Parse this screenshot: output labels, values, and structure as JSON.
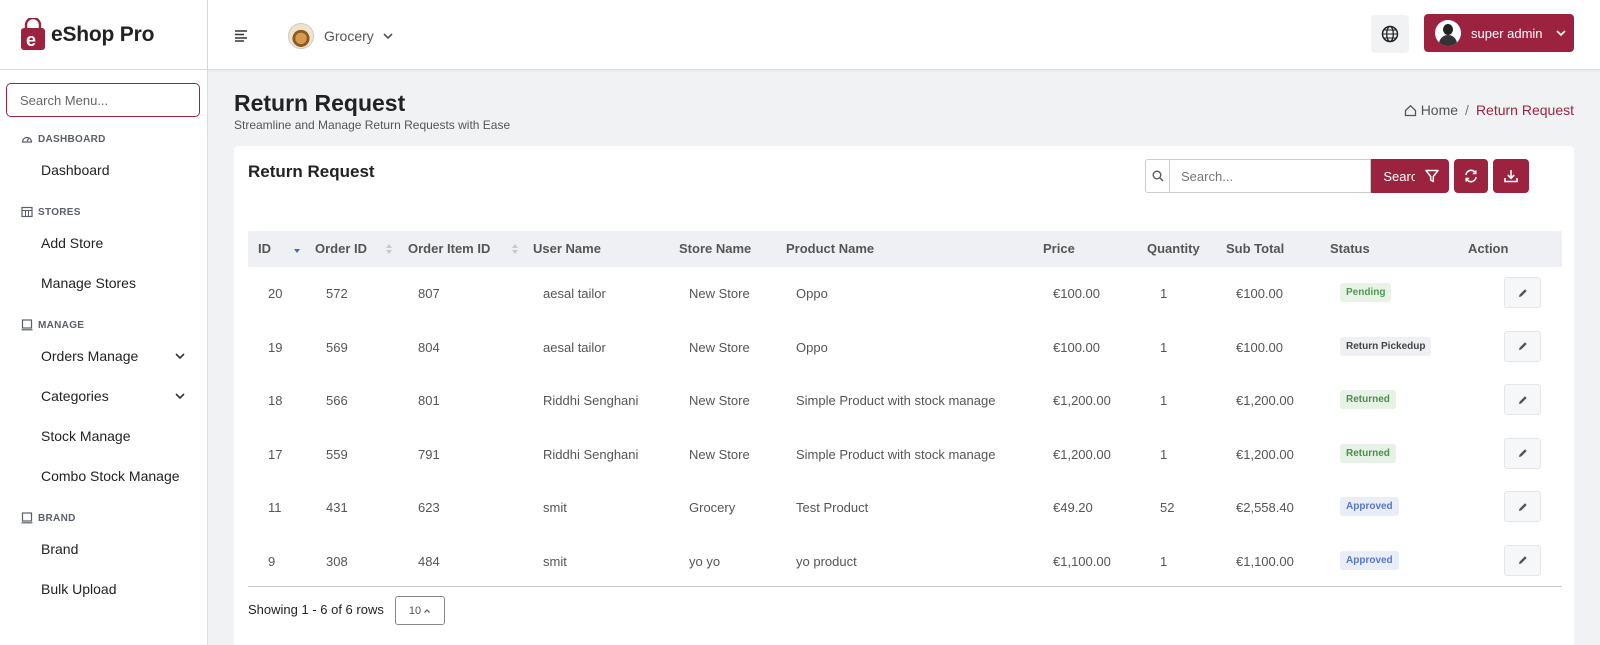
{
  "app": {
    "name": "eShop Pro"
  },
  "sidebar": {
    "search_placeholder": "Search Menu...",
    "sections": [
      {
        "label": "DASHBOARD",
        "icon": "gauge-icon",
        "items": [
          {
            "label": "Dashboard"
          }
        ]
      },
      {
        "label": "STORES",
        "icon": "store-icon",
        "items": [
          {
            "label": "Add Store"
          },
          {
            "label": "Manage Stores"
          }
        ]
      },
      {
        "label": "MANAGE",
        "icon": "tablet-icon",
        "items": [
          {
            "label": "Orders Manage",
            "expandable": true
          },
          {
            "label": "Categories",
            "expandable": true
          },
          {
            "label": "Stock Manage"
          },
          {
            "label": "Combo Stock Manage"
          }
        ]
      },
      {
        "label": "BRAND",
        "icon": "tablet-icon",
        "items": [
          {
            "label": "Brand"
          },
          {
            "label": "Bulk Upload"
          }
        ]
      }
    ]
  },
  "topbar": {
    "store_name": "Grocery",
    "user_name": "super admin"
  },
  "page": {
    "title": "Return Request",
    "subtitle": "Streamline and Manage Return Requests with Ease",
    "breadcrumb": {
      "home": "Home",
      "separator": "/",
      "current": "Return Request"
    }
  },
  "card": {
    "title": "Return Request",
    "search_placeholder": "Search...",
    "search_button": "Search"
  },
  "table": {
    "columns": [
      "ID",
      "Order ID",
      "Order Item ID",
      "User Name",
      "Store Name",
      "Product Name",
      "Price",
      "Quantity",
      "Sub Total",
      "Status",
      "Action"
    ],
    "rows": [
      {
        "id": "20",
        "order_id": "572",
        "order_item_id": "807",
        "user_name": "aesal tailor",
        "store_name": "New Store",
        "product_name": "Oppo",
        "price": "€100.00",
        "quantity": "1",
        "sub_total": "€100.00",
        "status": "Pending"
      },
      {
        "id": "19",
        "order_id": "569",
        "order_item_id": "804",
        "user_name": "aesal tailor",
        "store_name": "New Store",
        "product_name": "Oppo",
        "price": "€100.00",
        "quantity": "1",
        "sub_total": "€100.00",
        "status": "Return Pickedup"
      },
      {
        "id": "18",
        "order_id": "566",
        "order_item_id": "801",
        "user_name": "Riddhi Senghani",
        "store_name": "New Store",
        "product_name": "Simple Product with stock manage",
        "price": "€1,200.00",
        "quantity": "1",
        "sub_total": "€1,200.00",
        "status": "Returned"
      },
      {
        "id": "17",
        "order_id": "559",
        "order_item_id": "791",
        "user_name": "Riddhi Senghani",
        "store_name": "New Store",
        "product_name": "Simple Product with stock manage",
        "price": "€1,200.00",
        "quantity": "1",
        "sub_total": "€1,200.00",
        "status": "Returned"
      },
      {
        "id": "11",
        "order_id": "431",
        "order_item_id": "623",
        "user_name": "smit",
        "store_name": "Grocery",
        "product_name": "Test Product",
        "price": "€49.20",
        "quantity": "52",
        "sub_total": "€2,558.40",
        "status": "Approved"
      },
      {
        "id": "9",
        "order_id": "308",
        "order_item_id": "484",
        "user_name": "smit",
        "store_name": "yo yo",
        "product_name": "yo product",
        "price": "€1,100.00",
        "quantity": "1",
        "sub_total": "€1,100.00",
        "status": "Approved"
      }
    ],
    "footer": {
      "showing": "Showing 1 - 6 of 6 rows",
      "page_size": "10"
    }
  },
  "colors": {
    "accent": "#9b2340",
    "sidebar_bg": "#ffffff",
    "page_bg": "#f1f2f4"
  }
}
